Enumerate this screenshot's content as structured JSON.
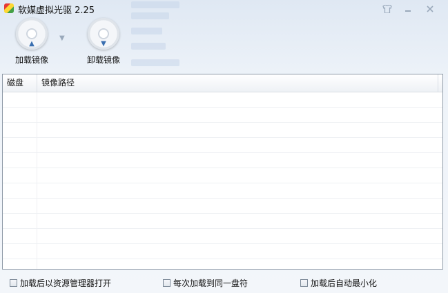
{
  "window": {
    "title": "软媒虚拟光驱 2.25",
    "icons": {
      "skin": "shirt-icon",
      "minimize": "minimize-icon",
      "close": "close-icon"
    }
  },
  "toolbar": {
    "mount_label": "加载镜像",
    "unmount_label": "卸载镜像"
  },
  "table": {
    "columns": [
      "磁盘",
      "镜像路径"
    ],
    "rows": []
  },
  "options": [
    {
      "label": "加载后以资源管理器打开",
      "checked": false
    },
    {
      "label": "每次加载到同一盘符",
      "checked": false
    },
    {
      "label": "加载后自动最小化",
      "checked": false
    }
  ],
  "colors": {
    "accent": "#3a6fb0",
    "border": "#8d99a6"
  }
}
